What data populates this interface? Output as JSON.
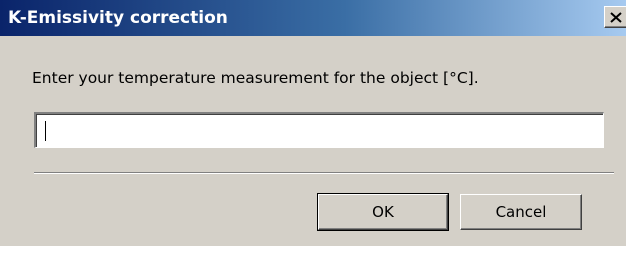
{
  "window": {
    "title": "K-Emissivity correction",
    "close_icon": "close-icon"
  },
  "prompt": {
    "text": "Enter your temperature measurement for the object [°C]."
  },
  "input": {
    "value": "",
    "placeholder": ""
  },
  "buttons": {
    "ok_label": "OK",
    "cancel_label": "Cancel"
  },
  "colors": {
    "titlebar_start": "#0a246a",
    "titlebar_end": "#a6caf0",
    "dialog_face": "#d4d0c8"
  }
}
